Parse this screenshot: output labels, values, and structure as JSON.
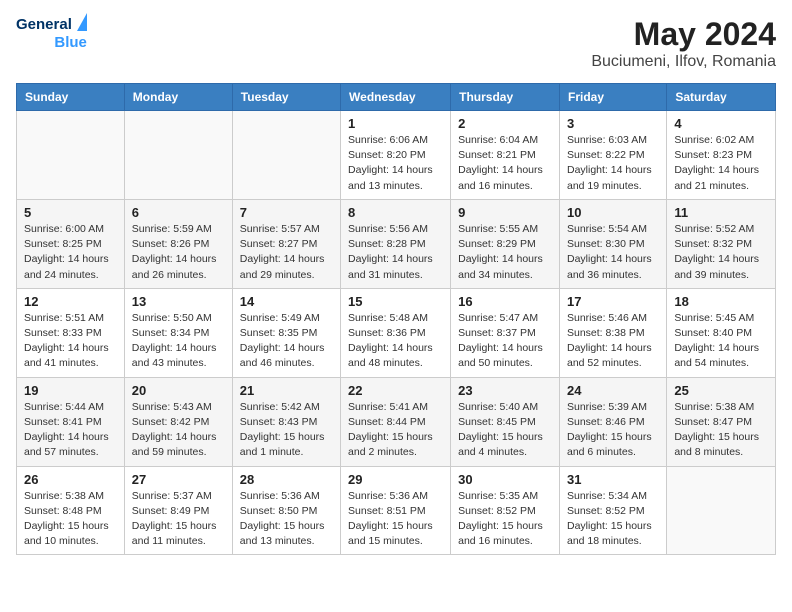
{
  "logo": {
    "line1": "General",
    "line2": "Blue"
  },
  "title": "May 2024",
  "subtitle": "Buciumeni, Ilfov, Romania",
  "weekdays": [
    "Sunday",
    "Monday",
    "Tuesday",
    "Wednesday",
    "Thursday",
    "Friday",
    "Saturday"
  ],
  "weeks": [
    [
      {
        "day": "",
        "detail": ""
      },
      {
        "day": "",
        "detail": ""
      },
      {
        "day": "",
        "detail": ""
      },
      {
        "day": "1",
        "detail": "Sunrise: 6:06 AM\nSunset: 8:20 PM\nDaylight: 14 hours\nand 13 minutes."
      },
      {
        "day": "2",
        "detail": "Sunrise: 6:04 AM\nSunset: 8:21 PM\nDaylight: 14 hours\nand 16 minutes."
      },
      {
        "day": "3",
        "detail": "Sunrise: 6:03 AM\nSunset: 8:22 PM\nDaylight: 14 hours\nand 19 minutes."
      },
      {
        "day": "4",
        "detail": "Sunrise: 6:02 AM\nSunset: 8:23 PM\nDaylight: 14 hours\nand 21 minutes."
      }
    ],
    [
      {
        "day": "5",
        "detail": "Sunrise: 6:00 AM\nSunset: 8:25 PM\nDaylight: 14 hours\nand 24 minutes."
      },
      {
        "day": "6",
        "detail": "Sunrise: 5:59 AM\nSunset: 8:26 PM\nDaylight: 14 hours\nand 26 minutes."
      },
      {
        "day": "7",
        "detail": "Sunrise: 5:57 AM\nSunset: 8:27 PM\nDaylight: 14 hours\nand 29 minutes."
      },
      {
        "day": "8",
        "detail": "Sunrise: 5:56 AM\nSunset: 8:28 PM\nDaylight: 14 hours\nand 31 minutes."
      },
      {
        "day": "9",
        "detail": "Sunrise: 5:55 AM\nSunset: 8:29 PM\nDaylight: 14 hours\nand 34 minutes."
      },
      {
        "day": "10",
        "detail": "Sunrise: 5:54 AM\nSunset: 8:30 PM\nDaylight: 14 hours\nand 36 minutes."
      },
      {
        "day": "11",
        "detail": "Sunrise: 5:52 AM\nSunset: 8:32 PM\nDaylight: 14 hours\nand 39 minutes."
      }
    ],
    [
      {
        "day": "12",
        "detail": "Sunrise: 5:51 AM\nSunset: 8:33 PM\nDaylight: 14 hours\nand 41 minutes."
      },
      {
        "day": "13",
        "detail": "Sunrise: 5:50 AM\nSunset: 8:34 PM\nDaylight: 14 hours\nand 43 minutes."
      },
      {
        "day": "14",
        "detail": "Sunrise: 5:49 AM\nSunset: 8:35 PM\nDaylight: 14 hours\nand 46 minutes."
      },
      {
        "day": "15",
        "detail": "Sunrise: 5:48 AM\nSunset: 8:36 PM\nDaylight: 14 hours\nand 48 minutes."
      },
      {
        "day": "16",
        "detail": "Sunrise: 5:47 AM\nSunset: 8:37 PM\nDaylight: 14 hours\nand 50 minutes."
      },
      {
        "day": "17",
        "detail": "Sunrise: 5:46 AM\nSunset: 8:38 PM\nDaylight: 14 hours\nand 52 minutes."
      },
      {
        "day": "18",
        "detail": "Sunrise: 5:45 AM\nSunset: 8:40 PM\nDaylight: 14 hours\nand 54 minutes."
      }
    ],
    [
      {
        "day": "19",
        "detail": "Sunrise: 5:44 AM\nSunset: 8:41 PM\nDaylight: 14 hours\nand 57 minutes."
      },
      {
        "day": "20",
        "detail": "Sunrise: 5:43 AM\nSunset: 8:42 PM\nDaylight: 14 hours\nand 59 minutes."
      },
      {
        "day": "21",
        "detail": "Sunrise: 5:42 AM\nSunset: 8:43 PM\nDaylight: 15 hours\nand 1 minute."
      },
      {
        "day": "22",
        "detail": "Sunrise: 5:41 AM\nSunset: 8:44 PM\nDaylight: 15 hours\nand 2 minutes."
      },
      {
        "day": "23",
        "detail": "Sunrise: 5:40 AM\nSunset: 8:45 PM\nDaylight: 15 hours\nand 4 minutes."
      },
      {
        "day": "24",
        "detail": "Sunrise: 5:39 AM\nSunset: 8:46 PM\nDaylight: 15 hours\nand 6 minutes."
      },
      {
        "day": "25",
        "detail": "Sunrise: 5:38 AM\nSunset: 8:47 PM\nDaylight: 15 hours\nand 8 minutes."
      }
    ],
    [
      {
        "day": "26",
        "detail": "Sunrise: 5:38 AM\nSunset: 8:48 PM\nDaylight: 15 hours\nand 10 minutes."
      },
      {
        "day": "27",
        "detail": "Sunrise: 5:37 AM\nSunset: 8:49 PM\nDaylight: 15 hours\nand 11 minutes."
      },
      {
        "day": "28",
        "detail": "Sunrise: 5:36 AM\nSunset: 8:50 PM\nDaylight: 15 hours\nand 13 minutes."
      },
      {
        "day": "29",
        "detail": "Sunrise: 5:36 AM\nSunset: 8:51 PM\nDaylight: 15 hours\nand 15 minutes."
      },
      {
        "day": "30",
        "detail": "Sunrise: 5:35 AM\nSunset: 8:52 PM\nDaylight: 15 hours\nand 16 minutes."
      },
      {
        "day": "31",
        "detail": "Sunrise: 5:34 AM\nSunset: 8:52 PM\nDaylight: 15 hours\nand 18 minutes."
      },
      {
        "day": "",
        "detail": ""
      }
    ]
  ]
}
